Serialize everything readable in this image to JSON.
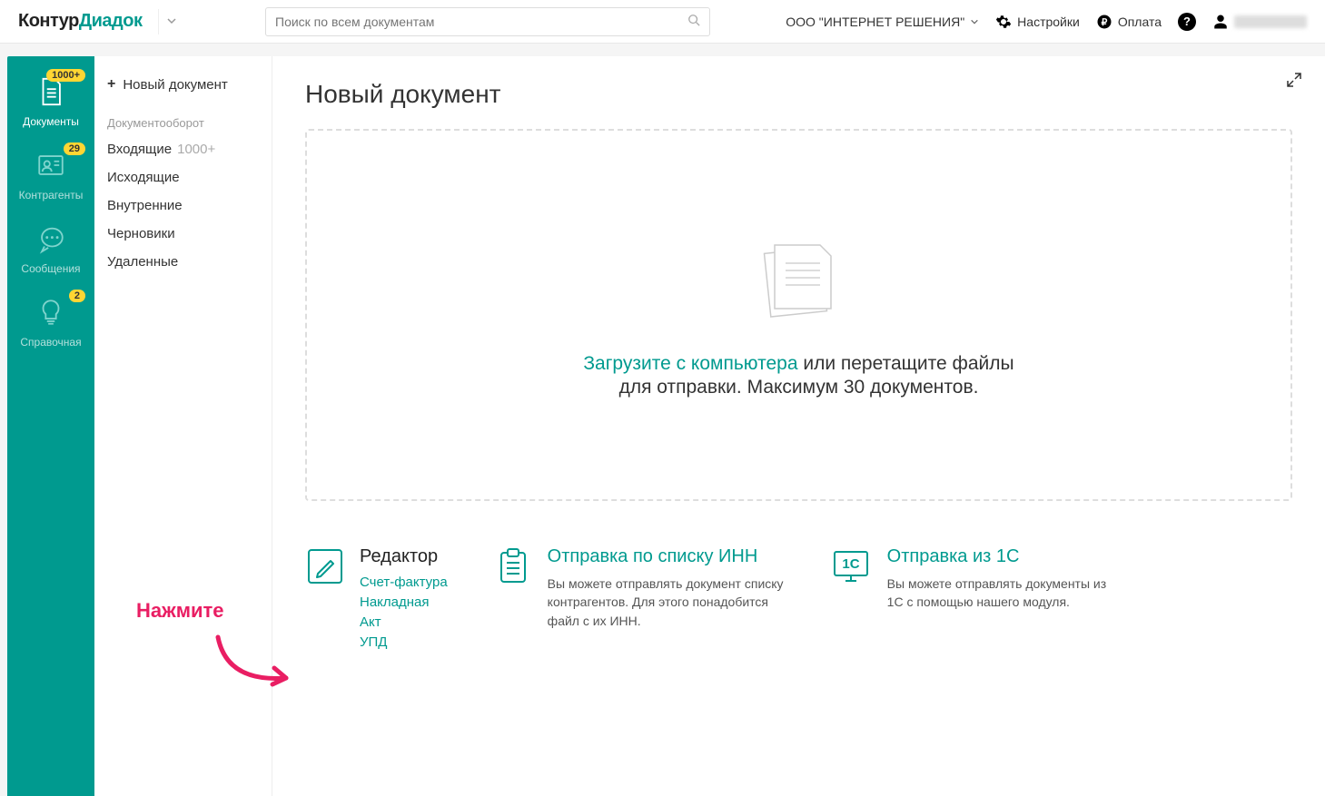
{
  "brand": {
    "part1": "Контур",
    "part2": "Диадок"
  },
  "search": {
    "placeholder": "Поиск по всем документам"
  },
  "org_name": "ООО \"ИНТЕРНЕТ РЕШЕНИЯ\"",
  "top_links": {
    "settings": "Настройки",
    "payment": "Оплата"
  },
  "sidebar": {
    "items": [
      {
        "label": "Документы",
        "badge": "1000+"
      },
      {
        "label": "Контрагенты",
        "badge": "29"
      },
      {
        "label": "Сообщения",
        "badge": ""
      },
      {
        "label": "Справочная",
        "badge": "2"
      }
    ]
  },
  "subnav": {
    "new_doc": "Новый документ",
    "section": "Документооборот",
    "items": [
      {
        "label": "Входящие",
        "count": "1000+"
      },
      {
        "label": "Исходящие",
        "count": ""
      },
      {
        "label": "Внутренние",
        "count": ""
      },
      {
        "label": "Черновики",
        "count": ""
      },
      {
        "label": "Удаленные",
        "count": ""
      }
    ]
  },
  "page_title": "Новый документ",
  "dropzone": {
    "link": "Загрузите с компьютера",
    "rest1": " или перетащите файлы",
    "line2": "для отправки. Максимум 30 документов."
  },
  "actions": {
    "editor": {
      "title": "Редактор",
      "links": [
        "Счет-фактура",
        "Накладная",
        "Акт",
        "УПД"
      ]
    },
    "inn": {
      "title": "Отправка по списку ИНН",
      "desc": "Вы можете отправлять документ списку контрагентов. Для этого понадобится файл с их ИНН."
    },
    "onec": {
      "title": "Отправка из 1С",
      "desc": "Вы можете отправлять документы из 1С с помощью нашего модуля.",
      "icon_label": "1С"
    }
  },
  "annotation": "Нажмите"
}
